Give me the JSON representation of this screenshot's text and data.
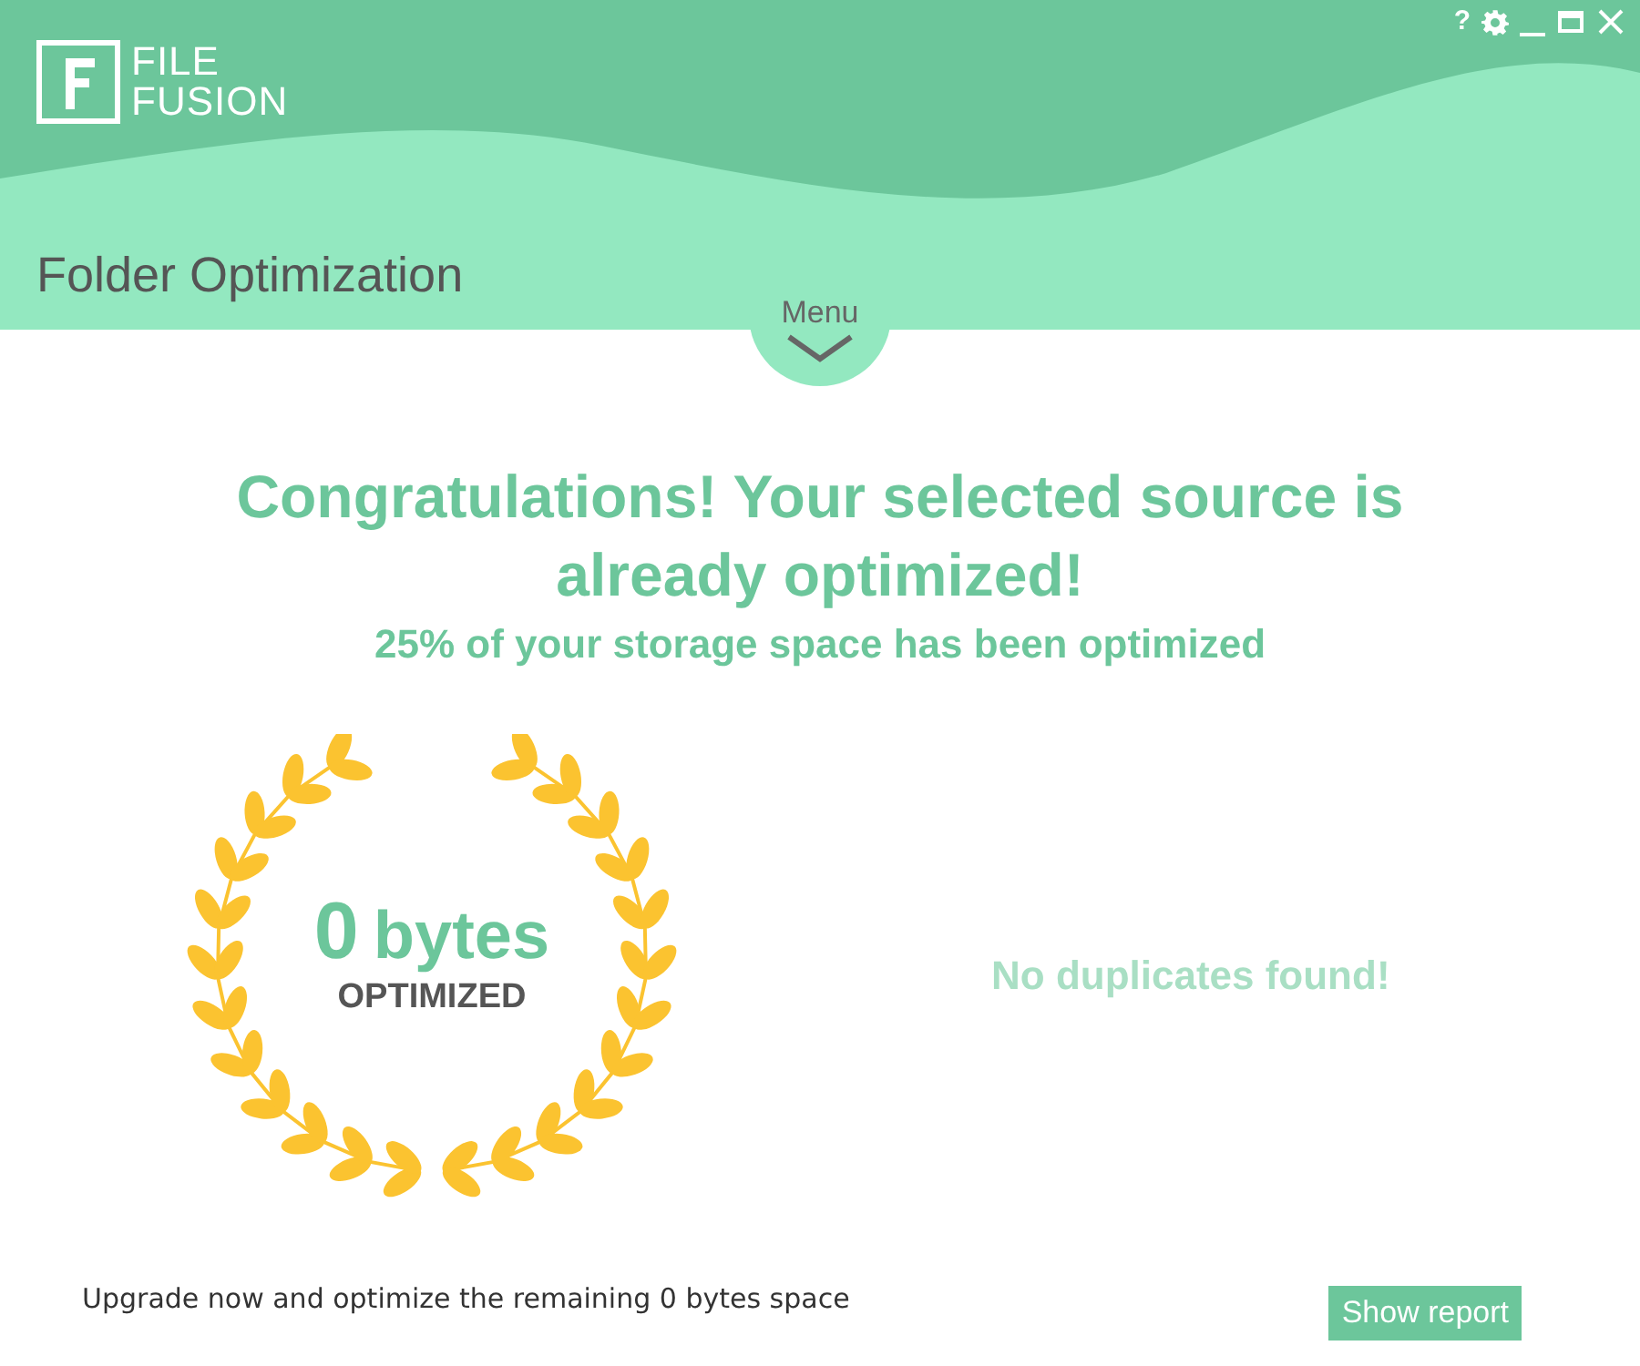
{
  "logo": {
    "line_1": "FILE",
    "line_2": "FUSION"
  },
  "window_controls": {
    "help": "?"
  },
  "header": {
    "title": "Folder Optimization",
    "menu": "Menu"
  },
  "result": {
    "heading": "Congratulations! Your selected source is already optimized!",
    "subheading": "25% of your storage space has been optimized",
    "amount": "0",
    "unit": "bytes",
    "amount_label": "OPTIMIZED",
    "duplicates_message": "No duplicates found!"
  },
  "footer": {
    "upgrade_text": "Upgrade now and optimize the remaining 0 bytes space",
    "button": "Show report"
  }
}
